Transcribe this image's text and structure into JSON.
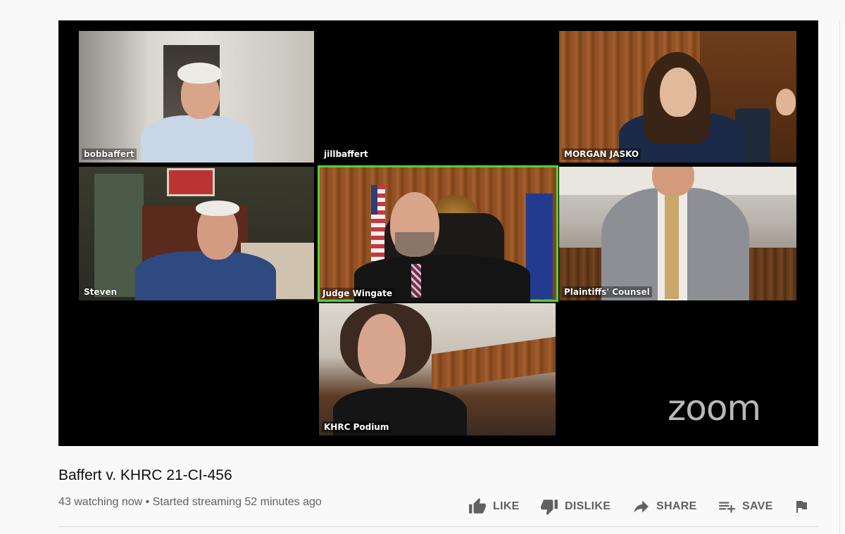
{
  "video": {
    "title": "Baffert v. KHRC 21-CI-456",
    "meta": "43 watching now • Started streaming 52 minutes ago",
    "watermark": "zoom"
  },
  "participants": [
    {
      "name": "bobbaffert",
      "active": false
    },
    {
      "name": "jillbaffert",
      "active": false
    },
    {
      "name": "MORGAN JASKO",
      "active": false
    },
    {
      "name": "Steven",
      "active": false
    },
    {
      "name": "Judge Wingate",
      "active": true
    },
    {
      "name": "Plaintiffs' Counsel",
      "active": false
    },
    {
      "name": "KHRC Podium",
      "active": false
    }
  ],
  "actions": {
    "like": {
      "label": "LIKE",
      "icon": "thumbs-up-icon"
    },
    "dislike": {
      "label": "DISLIKE",
      "icon": "thumbs-down-icon"
    },
    "share": {
      "label": "SHARE",
      "icon": "share-arrow-icon"
    },
    "save": {
      "label": "SAVE",
      "icon": "playlist-add-icon"
    },
    "report": {
      "icon": "flag-icon"
    }
  },
  "colors": {
    "active_speaker": "#56d12f",
    "text_primary": "#0f0f0f",
    "text_secondary": "#606060"
  }
}
